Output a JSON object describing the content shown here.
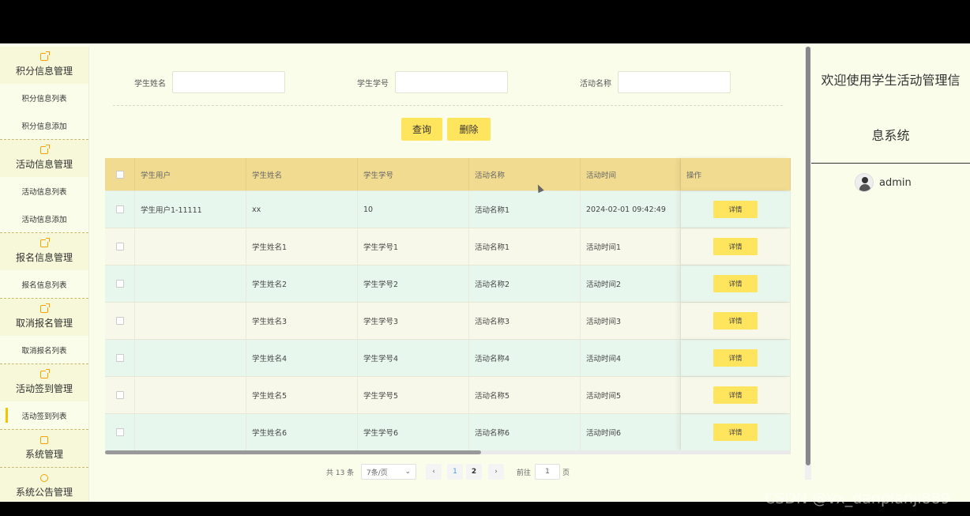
{
  "sidebar": {
    "groups": [
      {
        "title": "积分信息管理",
        "icon": "edit-icon",
        "items": [
          "积分信息列表",
          "积分信息添加"
        ]
      },
      {
        "title": "活动信息管理",
        "icon": "edit-icon",
        "items": [
          "活动信息列表",
          "活动信息添加"
        ]
      },
      {
        "title": "报名信息管理",
        "icon": "edit-icon",
        "items": [
          "报名信息列表"
        ]
      },
      {
        "title": "取消报名管理",
        "icon": "edit-icon",
        "items": [
          "取消报名列表"
        ]
      },
      {
        "title": "活动签到管理",
        "icon": "edit-icon",
        "items": [
          "活动签到列表"
        ]
      },
      {
        "title": "系统管理",
        "icon": "image-icon",
        "items": []
      },
      {
        "title": "系统公告管理",
        "icon": "info-circle-icon",
        "items": []
      }
    ],
    "active_item": "活动签到列表"
  },
  "search": {
    "student_name_label": "学生姓名",
    "student_no_label": "学生学号",
    "activity_name_label": "活动名称",
    "query_button": "查询",
    "delete_button": "删除"
  },
  "table": {
    "headers": [
      "学生用户",
      "学生姓名",
      "学生学号",
      "活动名称",
      "活动时间",
      "操作"
    ],
    "rows": [
      [
        "学生用户1-11111",
        "xx",
        "10",
        "活动名称1",
        "2024-02-01 09:42:49"
      ],
      [
        "",
        "学生姓名1",
        "学生学号1",
        "活动名称1",
        "活动时间1"
      ],
      [
        "",
        "学生姓名2",
        "学生学号2",
        "活动名称2",
        "活动时间2"
      ],
      [
        "",
        "学生姓名3",
        "学生学号3",
        "活动名称3",
        "活动时间3"
      ],
      [
        "",
        "学生姓名4",
        "学生学号4",
        "活动名称4",
        "活动时间4"
      ],
      [
        "",
        "学生姓名5",
        "学生学号5",
        "活动名称5",
        "活动时间5"
      ],
      [
        "",
        "学生姓名6",
        "学生学号6",
        "活动名称6",
        "活动时间6"
      ]
    ],
    "detail_label": "详情"
  },
  "pagination": {
    "total_text": "共 13 条",
    "page_size": "7条/页",
    "pages": [
      "1",
      "2"
    ],
    "current_page": "1",
    "goto_label": "前往",
    "goto_value": "1",
    "page_suffix": "页"
  },
  "header": {
    "welcome_line1": "欢迎使用学生活动管理信",
    "welcome_line2": "息系统",
    "username": "admin"
  },
  "watermark": "CSDN @vx_danpianji889",
  "colors": {
    "accent": "#ffe45e",
    "table_header": "#f0db90",
    "active_marker": "#f5c400"
  }
}
